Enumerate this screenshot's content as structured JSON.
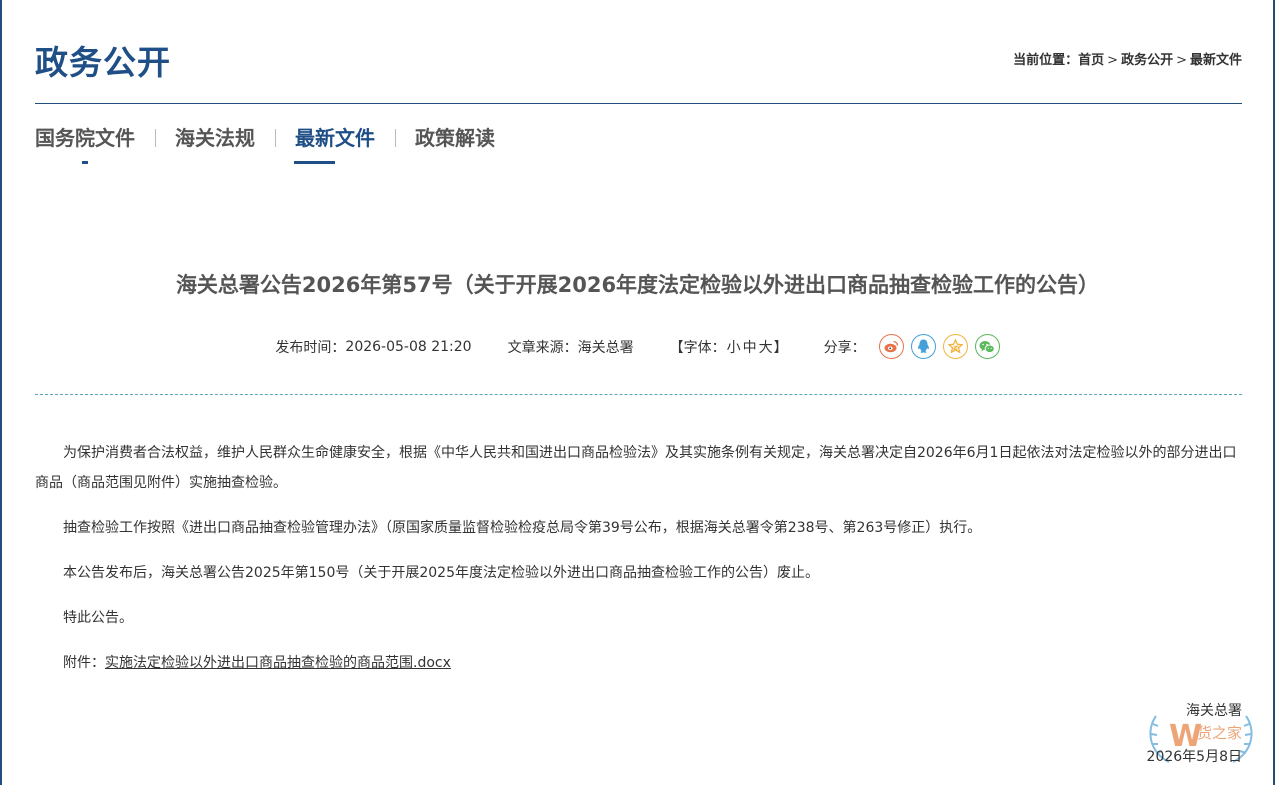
{
  "header": {
    "section_title": "政务公开",
    "breadcrumb": {
      "prefix": "当前位置：",
      "items": [
        "首页",
        "政务公开",
        "最新文件"
      ],
      "separator": ">"
    }
  },
  "tabs": [
    {
      "label": "国务院文件"
    },
    {
      "label": "海关法规"
    },
    {
      "label": "最新文件",
      "active": true
    },
    {
      "label": "政策解读"
    }
  ],
  "article": {
    "title": "海关总署公告2026年第57号（关于开展2026年度法定检验以外进出口商品抽查检验工作的公告）",
    "meta": {
      "publish_label": "发布时间：",
      "publish_time": "2026-05-08 21:20",
      "source_label": "文章来源：",
      "source": "海关总署",
      "font_open": "【字体：",
      "font_small": "小",
      "font_medium": "中",
      "font_large": "大",
      "font_close": "】",
      "share_label": "分享："
    },
    "paragraphs": [
      "为保护消费者合法权益，维护人民群众生命健康安全，根据《中华人民共和国进出口商品检验法》及其实施条例有关规定，海关总署决定自2026年6月1日起依法对法定检验以外的部分进出口商品（商品范围见附件）实施抽查检验。",
      "抽查检验工作按照《进出口商品抽查检验管理办法》（原国家质量监督检验检疫总局令第39号公布，根据海关总署令第238号、第263号修正）执行。",
      "本公告发布后，海关总署公告2025年第150号（关于开展2025年度法定检验以外进出口商品抽查检验工作的公告）废止。",
      "特此公告。"
    ],
    "attachment_label": "附件：",
    "attachment_name": "实施法定检验以外进出口商品抽查检验的商品范围.docx",
    "signature": "海关总署",
    "date": "2026年5月8日"
  },
  "share_icons": [
    "weibo-icon",
    "qq-icon",
    "qzone-icon",
    "wechat-icon"
  ],
  "watermark": {
    "text": "货之家"
  },
  "colors": {
    "brand": "#1f4f86",
    "rule_dashed": "#5aa7b8"
  }
}
